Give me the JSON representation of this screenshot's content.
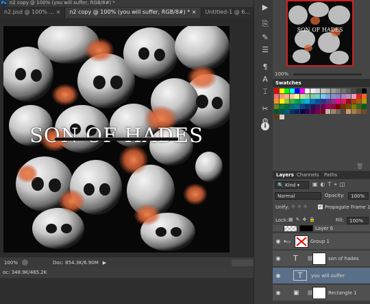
{
  "window": {
    "title_fragment": "n2 copy @ 100% (you will suffer, RGB/8#) *"
  },
  "tabs": [
    {
      "label": "n2.psd @ 100% ..."
    },
    {
      "label": "n2 copy @ 100% (you will suffer, RGB/8#) *"
    },
    {
      "label": "Untitled-1 @ 6..."
    }
  ],
  "canvas": {
    "headline": "SON OF HADES"
  },
  "status": {
    "zoom": "100%",
    "doc": "Doc: 854.3K/6.90M"
  },
  "bottom": {
    "doc": "oc: 348.9K/465.2K"
  },
  "navigator": {
    "zoom": "100%",
    "thumb_text": "SON OF HADES"
  },
  "swatches": {
    "title": "Swatches",
    "colors": [
      "#ff0000",
      "#ffff00",
      "#00ff00",
      "#00ffff",
      "#0000ff",
      "#ff00ff",
      "#ffffff",
      "#ebebeb",
      "#d6d6d6",
      "#c2c2c2",
      "#adadad",
      "#999999",
      "#858585",
      "#707070",
      "#5c5c5c",
      "#474747",
      "#333333",
      "#000000",
      "#f26d7d",
      "#f7977a",
      "#fbad82",
      "#fdc68c",
      "#fff799",
      "#c4df9b",
      "#a3d39c",
      "#82ca9c",
      "#7bcdc8",
      "#6ecff6",
      "#7ea7d8",
      "#8493ca",
      "#8882be",
      "#a187be",
      "#bc8dbf",
      "#f49ac2",
      "#ed1c24",
      "#f26522",
      "#f7941d",
      "#fff200",
      "#8dc63f",
      "#39b54a",
      "#00a651",
      "#00a99d",
      "#00aeef",
      "#0072bc",
      "#0054a6",
      "#2e3192",
      "#662d91",
      "#92278f",
      "#ec008c",
      "#ed145b",
      "#9e0b0f",
      "#a0410d",
      "#a36209",
      "#aba000",
      "#598527",
      "#1a7b30",
      "#007236",
      "#00746b",
      "#0076a3",
      "#004b80",
      "#003471",
      "#1b1464",
      "#440e62",
      "#630460",
      "#9e005d",
      "#9e0039",
      "#790000",
      "#7b2e00",
      "#7d4900",
      "#827b00",
      "#406618",
      "#005e20",
      "#005826",
      "#005952",
      "#005b7f",
      "#003663",
      "#002157",
      "#0d004c",
      "#32004b",
      "#4b0049",
      "#7b0046",
      "#7a0026",
      "#c7b299",
      "#998675",
      "#736357",
      "#534741",
      "#c69c6d",
      "#a67c52",
      "#8c6239",
      "#754c24",
      "#603913",
      "#d9d1c6"
    ]
  },
  "layers": {
    "tabs": [
      "Layers",
      "Channels",
      "Paths"
    ],
    "kind": "Kind",
    "blend": "Normal",
    "opacity_label": "Opacity:",
    "opacity": "100%",
    "unify_label": "Unify:",
    "propagate": "Propagate Frame 1",
    "lock_label": "Lock:",
    "fill_label": "Fill:",
    "fill": "100%",
    "items": [
      {
        "name": "Layer 6"
      },
      {
        "name": "Group 1"
      },
      {
        "name": "son of hades"
      },
      {
        "name": "you will suffer"
      },
      {
        "name": "Rectangle 1"
      }
    ]
  }
}
